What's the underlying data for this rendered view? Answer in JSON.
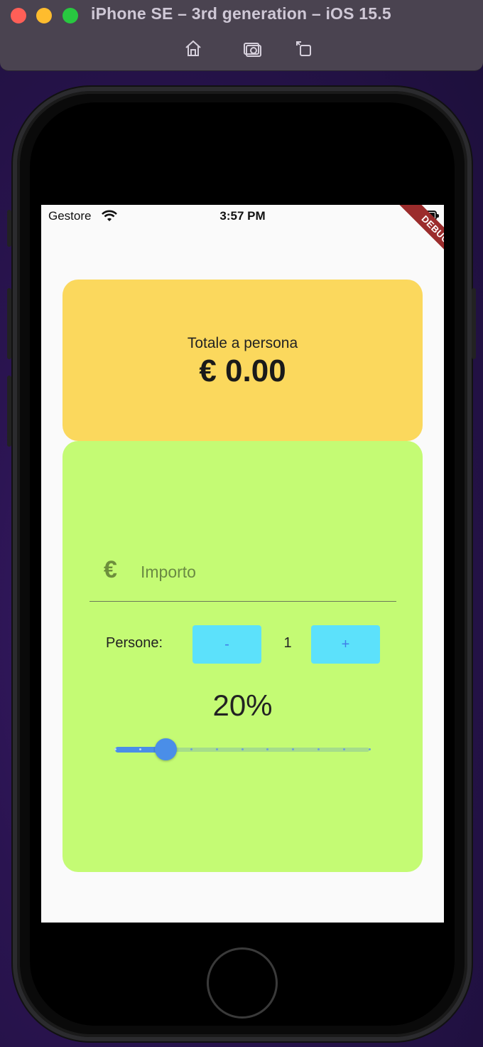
{
  "simulator": {
    "title": "iPhone SE – 3rd generation – iOS 15.5",
    "tools": [
      "home-icon",
      "screenshot-icon",
      "rotate-icon"
    ]
  },
  "status_bar": {
    "carrier": "Gestore",
    "time": "3:57 PM",
    "debug_banner": "DEBUG"
  },
  "total_card": {
    "label": "Totale a persona",
    "value": "€ 0.00",
    "color": "#fbd85d"
  },
  "form_card": {
    "color": "#c4fb74",
    "amount": {
      "icon": "euro-icon",
      "icon_glyph": "€",
      "placeholder": "Importo",
      "value": ""
    },
    "people": {
      "label": "Persone:",
      "minus_label": "-",
      "plus_label": "+",
      "count": "1"
    },
    "tip": {
      "percent_text": "20%",
      "slider_value": 0.2,
      "slider_divisions": 10
    }
  }
}
